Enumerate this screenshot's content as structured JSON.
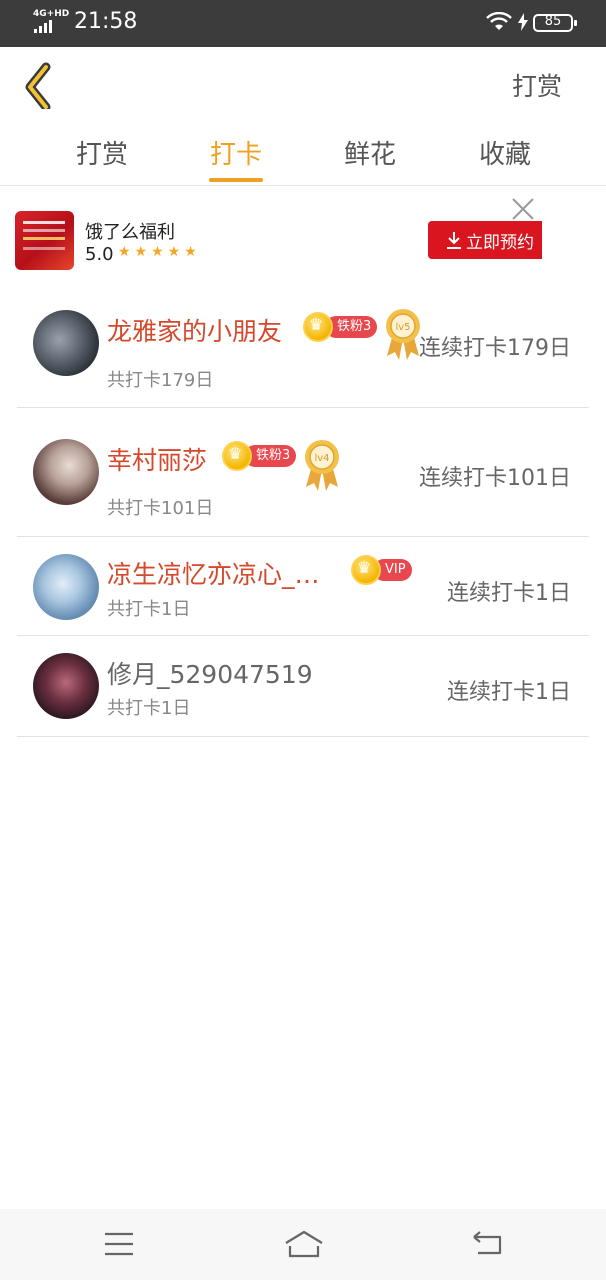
{
  "status_bar": {
    "network": "4G+HD",
    "time": "21:58",
    "battery": "85"
  },
  "header": {
    "action_label": "打赏"
  },
  "tabs": [
    {
      "label": "打赏",
      "active": false
    },
    {
      "label": "打卡",
      "active": true
    },
    {
      "label": "鲜花",
      "active": false
    },
    {
      "label": "收藏",
      "active": false
    }
  ],
  "ad": {
    "title": "饿了么福利",
    "rating": "5.0",
    "stars": "★★★★★",
    "button_label": "立即预约"
  },
  "checkins": [
    {
      "name": "龙雅家的小朋友",
      "fan_badge": "铁粉3",
      "level_medal": "lv5",
      "total": "共打卡179日",
      "streak": "连续打卡179日"
    },
    {
      "name": "幸村丽莎",
      "fan_badge": "铁粉3",
      "level_medal": "lv4",
      "total": "共打卡101日",
      "streak": "连续打卡101日"
    },
    {
      "name": "凉生凉忆亦凉心_…",
      "fan_badge": "VIP",
      "total": "共打卡1日",
      "streak": "连续打卡1日"
    },
    {
      "name": "修月_529047519",
      "total": "共打卡1日",
      "streak": "连续打卡1日"
    }
  ],
  "colors": {
    "accent": "#f0a020",
    "name_red": "#d4492c",
    "badge_red": "#e8484d",
    "ad_button": "#d9151f"
  }
}
